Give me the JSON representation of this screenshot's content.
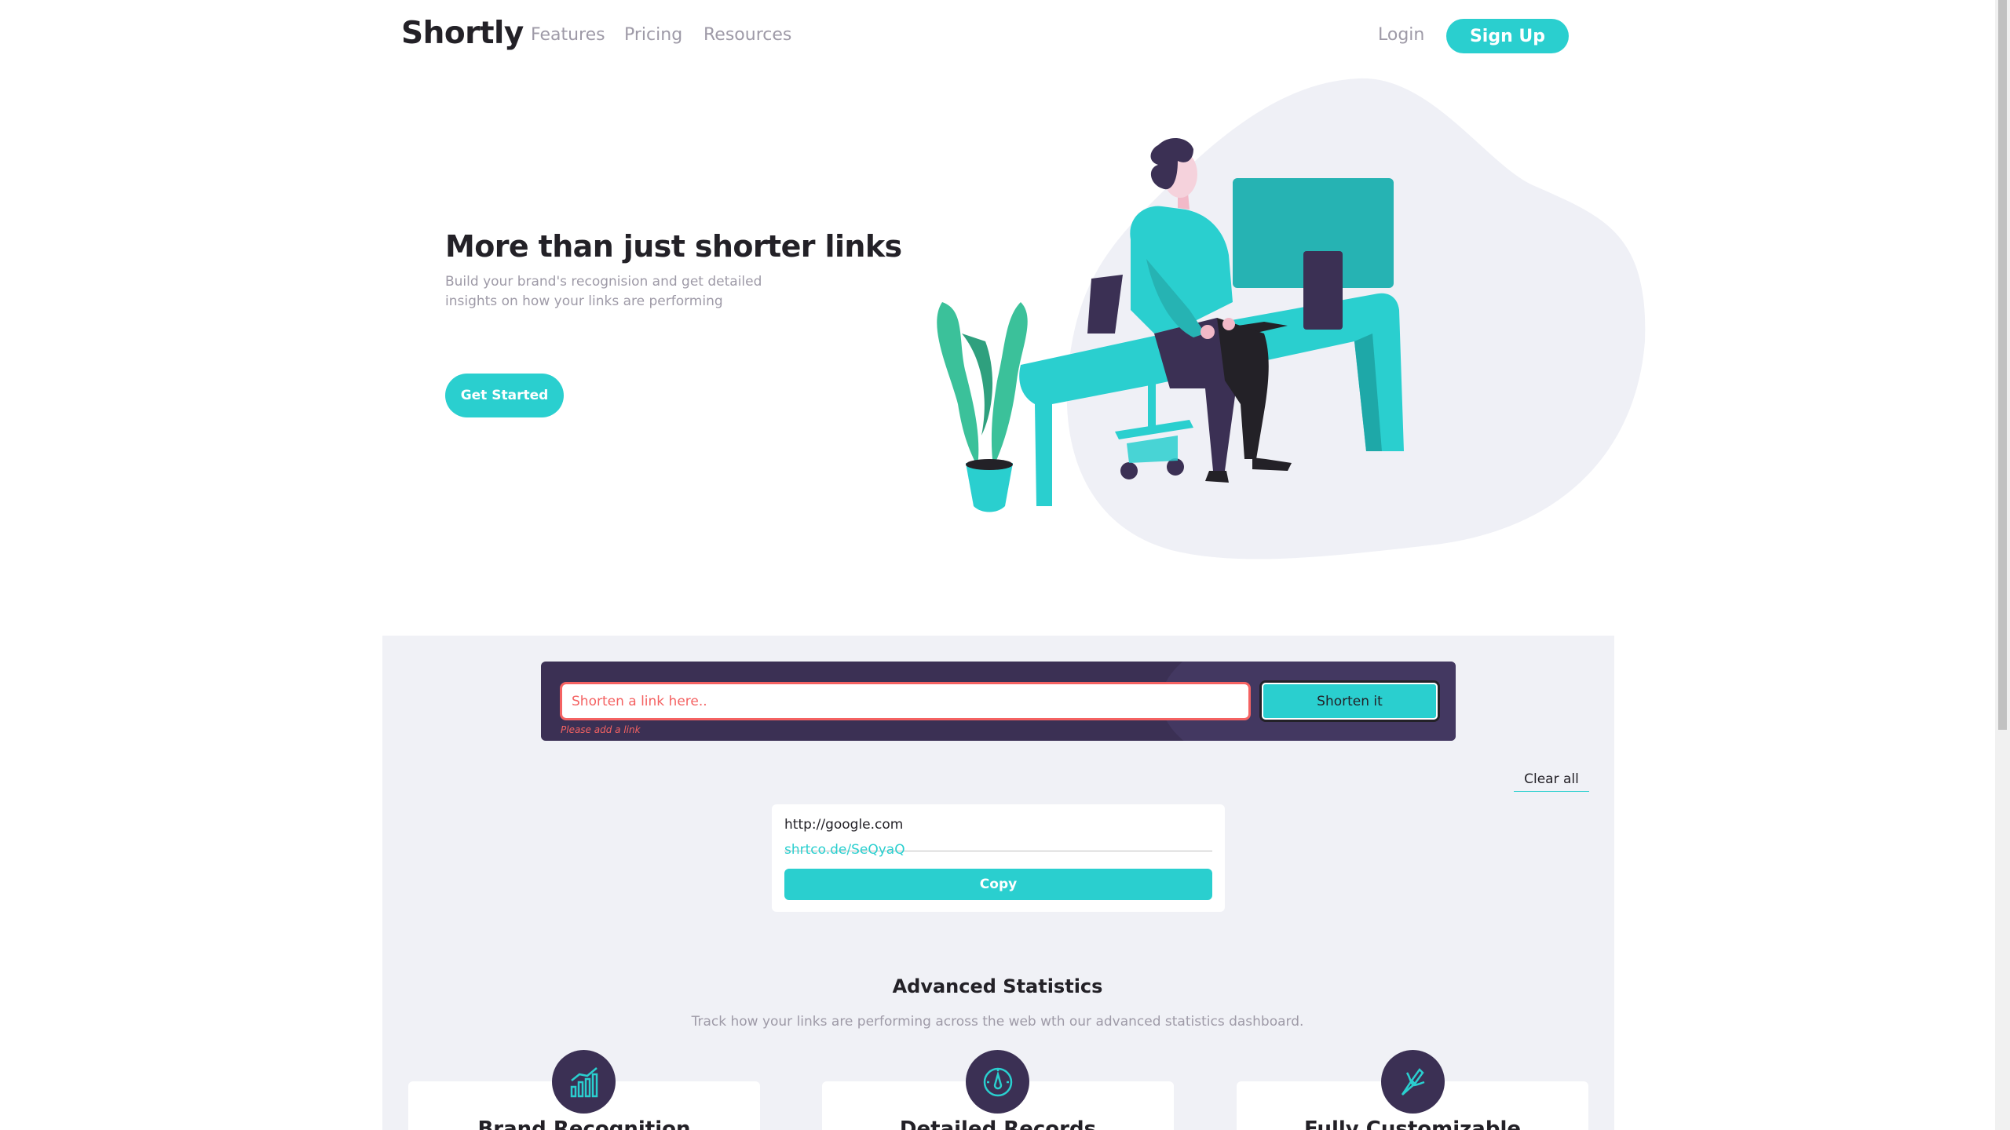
{
  "header": {
    "logo": "Shortly",
    "nav": {
      "features": "Features",
      "pricing": "Pricing",
      "resources": "Resources"
    },
    "login": "Login",
    "signup": "Sign Up"
  },
  "hero": {
    "title": "More than just shorter links",
    "subtitle": "Build your brand's recognision and get detailed insights on how your links are performing",
    "cta": "Get Started"
  },
  "shortener": {
    "placeholder": "Shorten a link here..",
    "button": "Shorten it",
    "error": "Please add a link"
  },
  "results": {
    "clear_all": "Clear all",
    "items": [
      {
        "original": "http://google.com",
        "short": "shrtco.de/SeQyaQ",
        "copy_label": "Copy"
      }
    ]
  },
  "stats": {
    "title": "Advanced Statistics",
    "subtitle": "Track how your links are performing across the web wth our advanced statistics dashboard.",
    "features": [
      {
        "title": "Brand Recognition",
        "icon": "bar-chart-icon"
      },
      {
        "title": "Detailed Records",
        "icon": "gauge-icon"
      },
      {
        "title": "Fully Customizable",
        "icon": "brush-icon"
      }
    ]
  },
  "colors": {
    "cyan": "#2acfcf",
    "dark_violet": "#3b3054",
    "red": "#f46262",
    "gray": "#9e9aa7",
    "section_bg": "#f0f1f6"
  }
}
